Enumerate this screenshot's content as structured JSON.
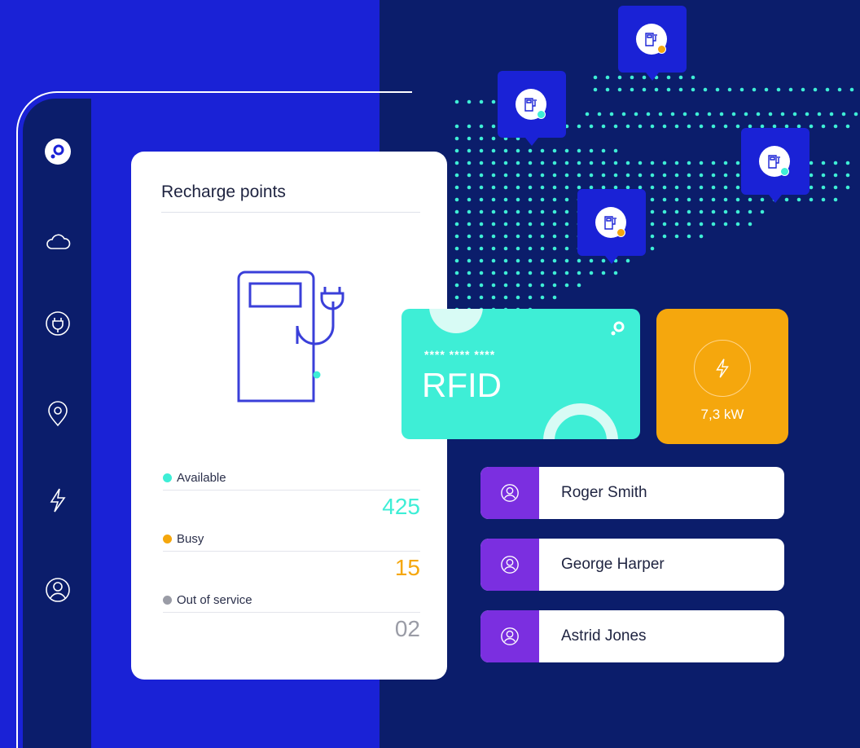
{
  "sidebar": {
    "icons": [
      "brand-logo-icon",
      "cloud-icon",
      "plug-icon",
      "location-pin-icon",
      "lightning-icon",
      "user-icon"
    ]
  },
  "recharge_card": {
    "title": "Recharge points",
    "statuses": [
      {
        "label": "Available",
        "value": "425",
        "color": "#3eeed6"
      },
      {
        "label": "Busy",
        "value": "15",
        "color": "#f5a70d"
      },
      {
        "label": "Out of service",
        "value": "02",
        "color": "#9a9ca6"
      }
    ]
  },
  "map_pins": [
    {
      "status_color": "#3eeed6"
    },
    {
      "status_color": "#f5a70d"
    },
    {
      "status_color": "#3eeed6"
    },
    {
      "status_color": "#f5a70d"
    }
  ],
  "rfid_card": {
    "masked_number": "**** **** ****",
    "label": "RFID"
  },
  "power_card": {
    "value": "7,3 kW"
  },
  "users": [
    {
      "name": "Roger Smith"
    },
    {
      "name": "George Harper"
    },
    {
      "name": "Astrid Jones"
    }
  ],
  "colors": {
    "brand_blue": "#1a22d6",
    "navy": "#0b1d6b",
    "teal": "#3eeed6",
    "orange": "#f5a70d",
    "purple": "#7b2fe0"
  }
}
